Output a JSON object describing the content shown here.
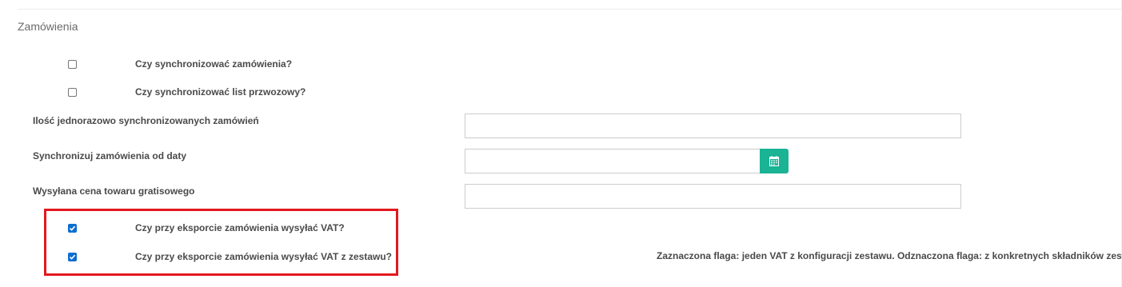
{
  "section": {
    "title": "Zamówienia"
  },
  "checkboxes": {
    "sync_orders": {
      "label": "Czy synchronizować zamówienia?",
      "checked": false
    },
    "sync_waybill": {
      "label": "Czy synchronizować list przwozowy?",
      "checked": false
    },
    "export_vat": {
      "label": "Czy przy eksporcie zamówienia wysyłać VAT?",
      "checked": true
    },
    "export_vat_set": {
      "label": "Czy przy eksporcie zamówienia wysyłać VAT z zestawu?",
      "checked": true
    }
  },
  "fields": {
    "batch_size": {
      "label": "Ilość jednorazowo synchronizowanych zamówień",
      "value": ""
    },
    "sync_from_date": {
      "label": "Synchronizuj zamówienia od daty",
      "value": "",
      "button_icon": "calendar-icon"
    },
    "free_item_price": {
      "label": "Wysyłana cena towaru gratisowego",
      "value": ""
    }
  },
  "help": {
    "vat_set_note": "Zaznaczona flaga: jeden VAT z konfiguracji zestawu. Odznaczona flaga: z konkretnych składników zestawu."
  },
  "colors": {
    "accent_button": "#1ab394",
    "highlight_border": "#e3181e",
    "checkbox_checked": "#0a6ed1"
  }
}
